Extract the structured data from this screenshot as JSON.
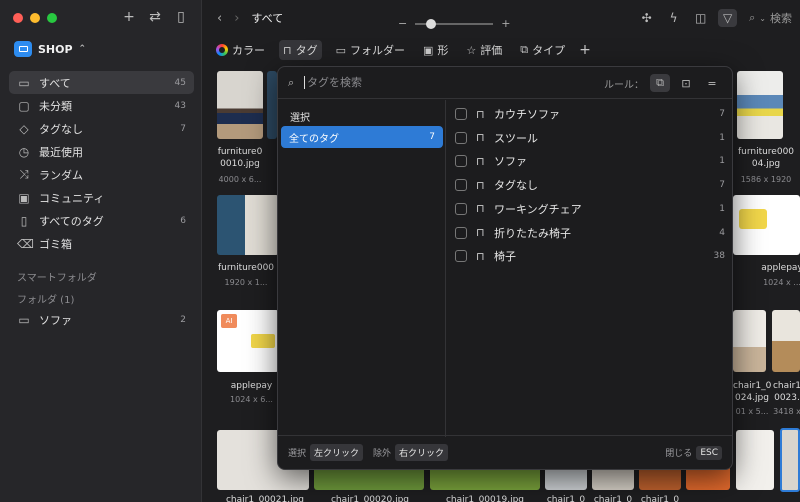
{
  "window": {
    "traffic_colors": [
      "#ff5f57",
      "#febc2e",
      "#28c840"
    ]
  },
  "sidebar": {
    "library_name": "SHOP",
    "library_chevron": "⌃",
    "top_icons": [
      "+",
      "⇄",
      "▯"
    ],
    "items": [
      {
        "icon": "inbox-icon",
        "glyph": "▭",
        "label": "すべて",
        "count": "45"
      },
      {
        "icon": "folder-question-icon",
        "glyph": "▢",
        "label": "未分類",
        "count": "43"
      },
      {
        "icon": "tag-outline-icon",
        "glyph": "◇",
        "label": "タグなし",
        "count": "7"
      },
      {
        "icon": "clock-icon",
        "glyph": "◷",
        "label": "最近使用",
        "count": ""
      },
      {
        "icon": "shuffle-icon",
        "glyph": "⤨",
        "label": "ランダム",
        "count": ""
      },
      {
        "icon": "community-icon",
        "glyph": "▣",
        "label": "コミュニティ",
        "count": ""
      },
      {
        "icon": "bookmark-icon",
        "glyph": "▯",
        "label": "すべてのタグ",
        "count": "6"
      },
      {
        "icon": "trash-icon",
        "glyph": "⌫",
        "label": "ゴミ箱",
        "count": ""
      }
    ],
    "smart_folder_heading": "スマートフォルダ",
    "folder_heading": "フォルダ (1)",
    "folders": [
      {
        "icon": "folder-icon",
        "glyph": "▭",
        "label": "ソファ",
        "count": "2"
      }
    ]
  },
  "topbar": {
    "back": "‹",
    "forward": "›",
    "title": "すべて",
    "zoom_minus": "−",
    "zoom_plus": "+",
    "zoom_level": 0.2,
    "search_placeholder": "検索"
  },
  "filterbar": {
    "items": [
      {
        "key": "color",
        "label": "カラー"
      },
      {
        "key": "tag",
        "label": "タグ"
      },
      {
        "key": "folder",
        "label": "フォルダー"
      },
      {
        "key": "shape",
        "label": "形"
      },
      {
        "key": "rating",
        "label": "評価"
      },
      {
        "key": "type",
        "label": "タイプ"
      }
    ],
    "add": "+"
  },
  "grid": {
    "items": [
      {
        "name": "furniture0\n0010.jpg",
        "dims": "4000 x 6..."
      },
      {
        "name": "furniture000\n04.jpg",
        "dims": "1586 x 1920"
      },
      {
        "name": "furniture000",
        "dims": "1920 x 1..."
      },
      {
        "name": "applepay",
        "dims": "1024 x ..."
      },
      {
        "name": "applepay",
        "dims": "1024 x 6..."
      },
      {
        "name": "chair1_0\n024.jpg",
        "dims": "01 x 5..."
      },
      {
        "name": "chair1\n0023.",
        "dims": "3418 x"
      },
      {
        "name": "chair1_00021.jpg",
        "dims": ""
      },
      {
        "name": "chair1_00020.jpg",
        "dims": ""
      },
      {
        "name": "chair1_00019.jpg",
        "dims": ""
      },
      {
        "name": "chair1_0",
        "dims": ""
      },
      {
        "name": "chair1_0",
        "dims": ""
      },
      {
        "name": "chair1_0",
        "dims": ""
      }
    ],
    "thumb_badge": "AI"
  },
  "popover": {
    "search_placeholder": "タグを検索",
    "rules_label": "ルール：",
    "select_title": "選択",
    "all_tags": {
      "label": "全てのタグ",
      "count": "7"
    },
    "tags": [
      {
        "label": "カウチソファ",
        "count": "7"
      },
      {
        "label": "スツール",
        "count": "1"
      },
      {
        "label": "ソファ",
        "count": "1"
      },
      {
        "label": "タグなし",
        "count": "7"
      },
      {
        "label": "ワーキングチェア",
        "count": "1"
      },
      {
        "label": "折りたたみ椅子",
        "count": "4"
      },
      {
        "label": "椅子",
        "count": "38"
      }
    ],
    "footer": {
      "select_label": "選択",
      "select_key": "左クリック",
      "exclude_label": "除外",
      "exclude_key": "右クリック",
      "close_label": "閉じる",
      "close_key": "ESC"
    }
  }
}
